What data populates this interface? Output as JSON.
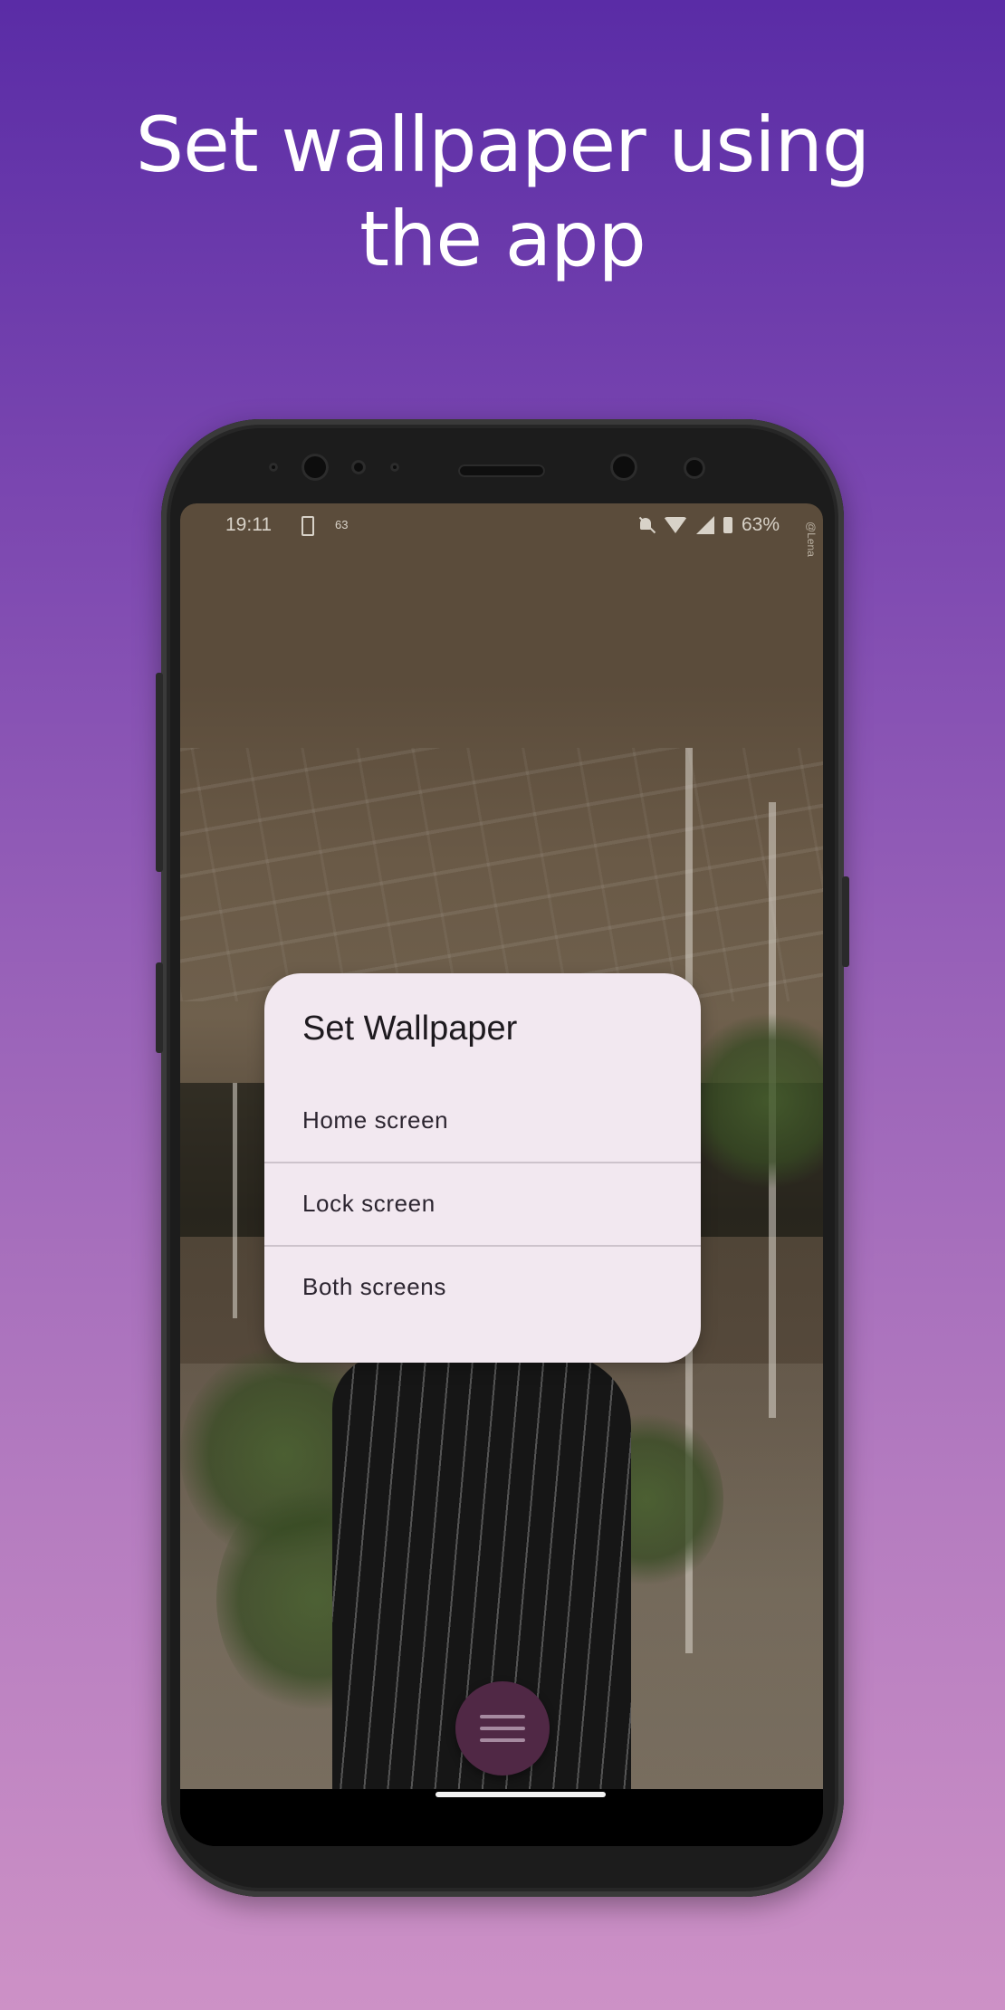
{
  "promo": {
    "headline_line1": "Set wallpaper using",
    "headline_line2": "the app"
  },
  "status_bar": {
    "time": "19:11",
    "battery_small": "63",
    "battery_percent": "63%",
    "watermark": "@Lena"
  },
  "dialog": {
    "title": "Set Wallpaper",
    "options": [
      "Home screen",
      "Lock screen",
      "Both screens"
    ]
  },
  "fab": {
    "icon": "menu-icon"
  },
  "colors": {
    "dialog_bg": "#f2e8f0",
    "fab_bg": "#502845",
    "gradient_top": "#5a2ca6",
    "gradient_bottom": "#cd91c6"
  }
}
